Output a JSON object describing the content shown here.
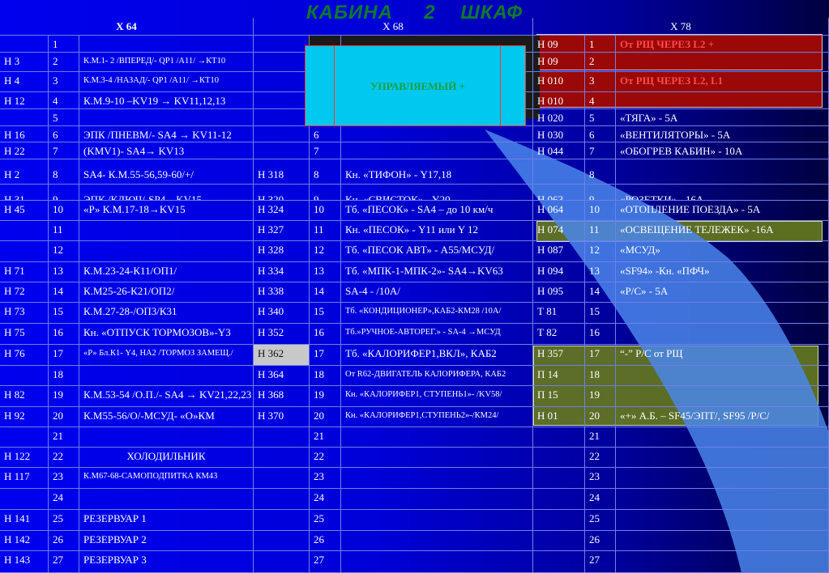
{
  "title": "КАБИНА     2    ШКАФ",
  "control_box_label": "УПРАВЛЯЕМЫЙ  +",
  "headers": {
    "x64": "Х 64",
    "x68": "Х 68",
    "x78": "Х 78"
  },
  "rows": [
    {
      "a1": "",
      "n1": "1",
      "d1": "",
      "a2": "",
      "n2": "",
      "d2": "",
      "a3": "Н 09",
      "n3": "1",
      "d3": "От РЩ ЧЕРЕЗ L2 +"
    },
    {
      "a1": "Н 3",
      "n1": "2",
      "d1": "К.М.1- 2 /ВПЕРЕД/- QP1  /A11/ →КТ10",
      "a2": "",
      "n2": "",
      "d2": "",
      "a3": "Н 09",
      "n3": "2",
      "d3": ""
    },
    {
      "a1": "Н 4",
      "n1": "3",
      "d1": "К.М.3-4 /НАЗАД/- QP1  /A11/ →КТ10",
      "a2": "",
      "n2": "",
      "d2": "",
      "a3": "Н 010",
      "n3": "3",
      "d3": "От РЩ ЧЕРЕЗ L2, L1"
    },
    {
      "a1": "Н 12",
      "n1": "4",
      "d1": "К.М.9-10 –KV19 → KV11,12,13",
      "a2": "",
      "n2": "",
      "d2": "",
      "a3": "Н 010",
      "n3": "4",
      "d3": ""
    },
    {
      "a1": "",
      "n1": "5",
      "d1": "",
      "a2": "",
      "n2": "",
      "d2": "",
      "a3": "Н 020",
      "n3": "5",
      "d3": "«ТЯГА» - 5А"
    },
    {
      "a1": "Н 16",
      "n1": "6",
      "d1": "ЭПК /ПНЕВМ/- SA4 → KV11-12",
      "a2": "",
      "n2": "6",
      "d2": "",
      "a3": "Н 030",
      "n3": "6",
      "d3": "«ВЕНТИЛЯТОРЫ» - 5А"
    },
    {
      "a1": "Н 22",
      "n1": "7",
      "d1": "(KMV1)- SA4→ KV13",
      "a2": "",
      "n2": "7",
      "d2": "",
      "a3": "Н 044",
      "n3": "7",
      "d3": "«ОБОГРЕВ КАБИН» - 10А"
    },
    {
      "a1": "Н 2",
      "n1": "8",
      "d1": "SA4- К.М.55-56,59-60/+/",
      "a2": "Н 318",
      "n2": "8",
      "d2": "Кн. «ТИФОН» - Y17,18",
      "a3": "",
      "n3": "8",
      "d3": ""
    },
    {
      "a1": "Н 31",
      "n1": "9",
      "d1": "ЭПК /КЛЮЧ/-SP4→KV15",
      "a2": "Н 320",
      "n2": "9",
      "d2": "Кн. «СВИСТОК» - Y20",
      "a3": "Н 063",
      "n3": "9",
      "d3": "«РОЗЕТКИ» - 16А"
    },
    {
      "a1": "Н 45",
      "n1": "10",
      "d1": "«Р»  К.М.17-18→KV15",
      "a2": "Н 324",
      "n2": "10",
      "d2": "Тб. «ПЕСОК» - SA4 – до 10 км/ч",
      "a3": "Н 064",
      "n3": "10",
      "d3": "«ОТОПЛЕНИЕ ПОЕЗДА» - 5А"
    },
    {
      "a1": "",
      "n1": "11",
      "d1": "",
      "a2": "Н 327",
      "n2": "11",
      "d2": "Кн.   «ПЕСОК» - Y11 или  Y 12",
      "a3": "Н 074",
      "n3": "11",
      "d3": "«ОСВЕЩЕНИЕ ТЕЛЕЖЕК» -16А"
    },
    {
      "a1": "",
      "n1": "12",
      "d1": "",
      "a2": "Н 328",
      "n2": "12",
      "d2": "Тб. «ПЕСОК АВТ» - А55/МСУД/",
      "a3": "Н 087",
      "n3": "12",
      "d3": "«МСУД»"
    },
    {
      "a1": "Н 71",
      "n1": "13",
      "d1": "К.М.23-24-К11/ОП1/",
      "a2": "Н 334",
      "n2": "13",
      "d2": "Тб. «МПК-1-МПК-2»- SA4→KV63",
      "a3": "Н 094",
      "n3": "13",
      "d3": "«SF94» -Кн. «ПФЧ»"
    },
    {
      "a1": "Н 72",
      "n1": "14",
      "d1": "К.М25-26-К21/ОП2/",
      "a2": "Н 338",
      "n2": "14",
      "d2": "SA-4 - /10А/",
      "a3": "Н 095",
      "n3": "14",
      "d3": "«Р/С» - 5А"
    },
    {
      "a1": "Н 73",
      "n1": "15",
      "d1": "К.М.27-28-/ОП3/К31",
      "a2": "Н 340",
      "n2": "15",
      "d2": "Тб. «КОНДИЦИОНЕР»,КАБ2-КМ28 /10А/",
      "a3": "Т 81",
      "n3": "15",
      "d3": ""
    },
    {
      "a1": "Н 75",
      "n1": "16",
      "d1": "Кн. «ОТПУСК ТОРМОЗОВ»-Y3",
      "a2": "Н 352",
      "n2": "16",
      "d2": "Тб.»РУЧНОЕ-АВТОРЕГ.» -  SA-4  →МСУД",
      "a3": "Т 82",
      "n3": "16",
      "d3": ""
    },
    {
      "a1": "Н 76",
      "n1": "17",
      "d1": "«Р» Бл.К1- Y4, НА2 /ТОРМОЗ ЗАМЕЩ./",
      "a2": "Н 362",
      "n2": "17",
      "d2": "Тб. «КАЛОРИФЕР1,ВКЛ», КАБ2",
      "a3": "Н 357",
      "n3": "17",
      "d3": "“-” Р/С от РЩ"
    },
    {
      "a1": "",
      "n1": "18",
      "d1": "",
      "a2": "Н 364",
      "n2": "18",
      "d2": "От R62-ДВИГАТЕЛЬ КАЛОРИФЕРА, КАБ2",
      "a3": "П 14",
      "n3": "18",
      "d3": ""
    },
    {
      "a1": "Н 82",
      "n1": "19",
      "d1": "К.М.53-54 /О.П./- SA4 → KV21,22,23",
      "a2": "Н 368",
      "n2": "19",
      "d2": "Кн. «КАЛОРИФЕР1, СТУПЕНЬ1»-      /KV58/",
      "a3": "П 15",
      "n3": "19",
      "d3": ""
    },
    {
      "a1": "Н 92",
      "n1": "20",
      "d1": "К.М55-56/О/-МСУД- «О»КМ",
      "a2": "Н 370",
      "n2": "20",
      "d2": "Кн. «КАЛОРИФЕР1,СТУПЕНЬ2»-/КМ24/",
      "a3": "Н 01",
      "n3": "20",
      "d3": "«+» А.Б. – SF45/ЭПТ/, SF95 /Р/С/"
    },
    {
      "a1": "",
      "n1": "21",
      "d1": "",
      "a2": "",
      "n2": "21",
      "d2": "",
      "a3": "",
      "n3": "21",
      "d3": ""
    },
    {
      "a1": "Н 122",
      "n1": "22",
      "d1": "ХОЛОДИЛЬНИК",
      "a2": "",
      "n2": "22",
      "d2": "",
      "a3": "",
      "n3": "22",
      "d3": ""
    },
    {
      "a1": "Н 117",
      "n1": "23",
      "d1": "К.М67-68-САМОПОДПИТКА КМ43",
      "a2": "",
      "n2": "23",
      "d2": "",
      "a3": "",
      "n3": "23",
      "d3": ""
    },
    {
      "a1": "",
      "n1": "24",
      "d1": "",
      "a2": "",
      "n2": "24",
      "d2": "",
      "a3": "",
      "n3": "24",
      "d3": ""
    },
    {
      "a1": "Н 141",
      "n1": "25",
      "d1": "РЕЗЕРВУАР 1",
      "a2": "",
      "n2": "25",
      "d2": "",
      "a3": "",
      "n3": "25",
      "d3": ""
    },
    {
      "a1": "Н 142",
      "n1": "26",
      "d1": "РЕЗЕРВУАР 2",
      "a2": "",
      "n2": "26",
      "d2": "",
      "a3": "",
      "n3": "26",
      "d3": ""
    },
    {
      "a1": "Н 143",
      "n1": "27",
      "d1": "РЕЗЕРВУАР 3",
      "a2": "",
      "n2": "27",
      "d2": "",
      "a3": "",
      "n3": "27",
      "d3": ""
    }
  ]
}
